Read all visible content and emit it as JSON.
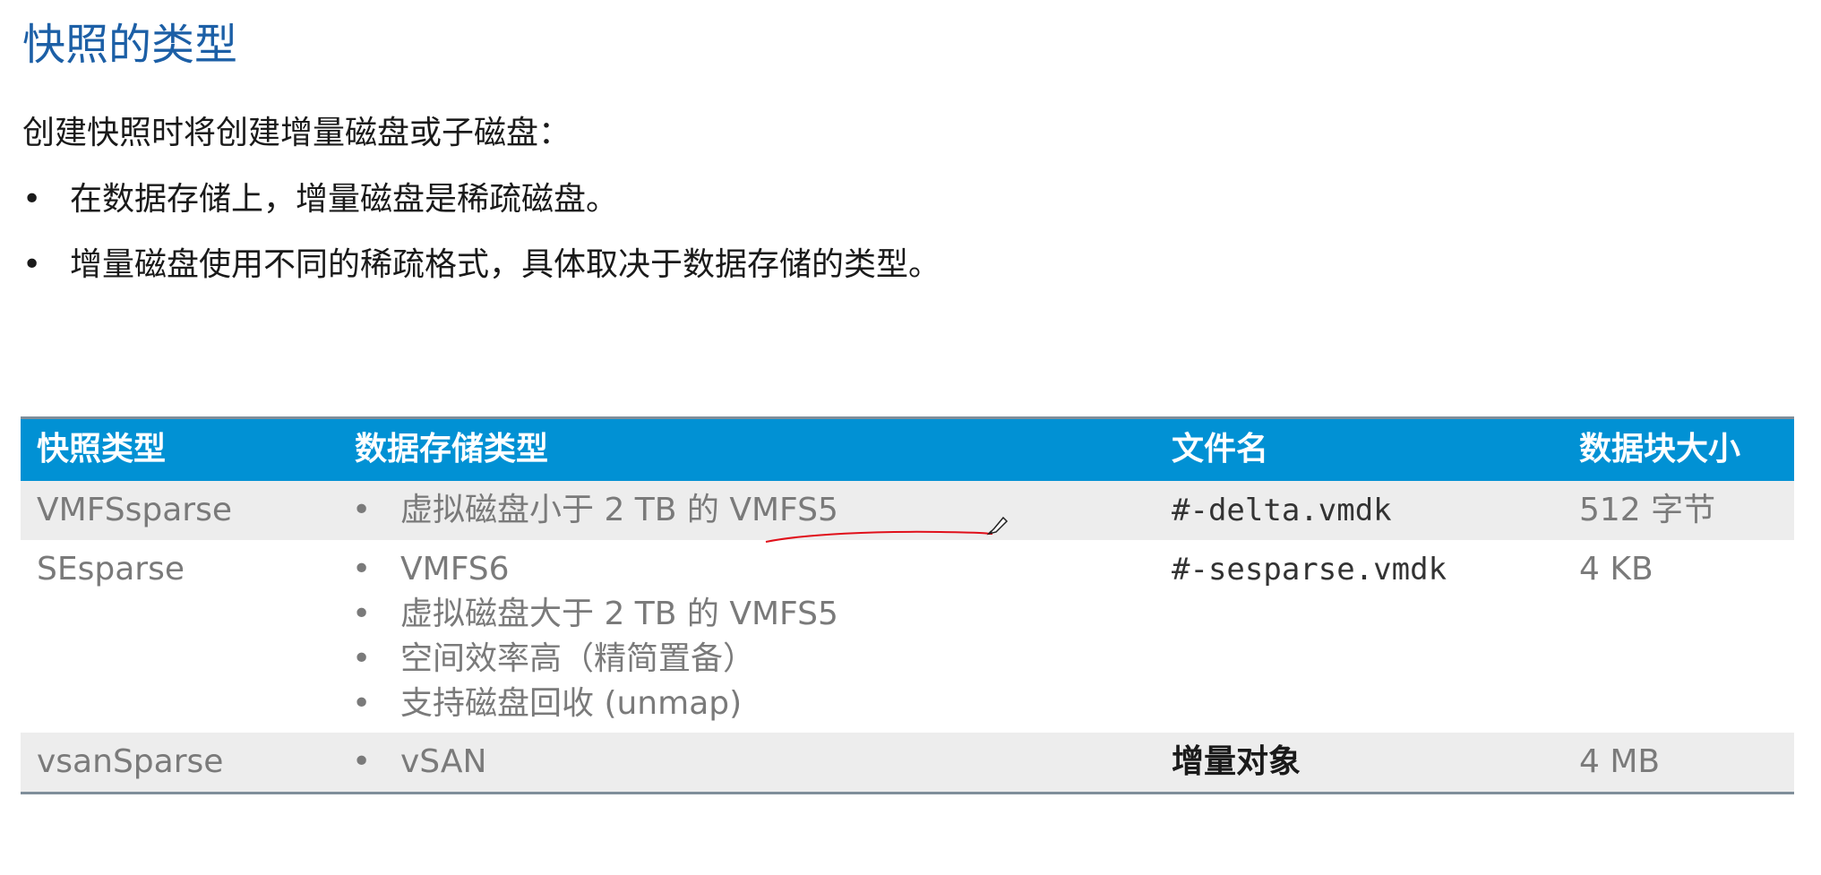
{
  "slide": {
    "title": "快照的类型",
    "intro": "创建快照时将创建增量磁盘或子磁盘：",
    "bullets": [
      "在数据存储上，增量磁盘是稀疏磁盘。",
      "增量磁盘使用不同的稀疏格式，具体取决于数据存储的类型。"
    ],
    "bullet_glyph": "•"
  },
  "table": {
    "headers": [
      "快照类型",
      "数据存储类型",
      "文件名",
      "数据块大小"
    ],
    "rows": [
      {
        "type": "VMFSsparse",
        "datastore": [
          "虚拟磁盘小于 2 TB 的 VMFS5"
        ],
        "filename": "#-delta.vmdk",
        "block_size": "512 字节"
      },
      {
        "type": "SEsparse",
        "datastore": [
          "VMFS6",
          "虚拟磁盘大于 2 TB 的 VMFS5",
          "空间效率高（精简置备）",
          "支持磁盘回收 (unmap)"
        ],
        "filename": "#-sesparse.vmdk",
        "block_size": "4 KB"
      },
      {
        "type": "vsanSparse",
        "datastore": [
          "vSAN"
        ],
        "filename": "增量对象",
        "block_size": "4 MB"
      }
    ],
    "colors": {
      "header_bg": "#0191d4",
      "shade_bg": "#ededed",
      "title": "#1c5fa6",
      "annotation": "#e0101a"
    }
  }
}
